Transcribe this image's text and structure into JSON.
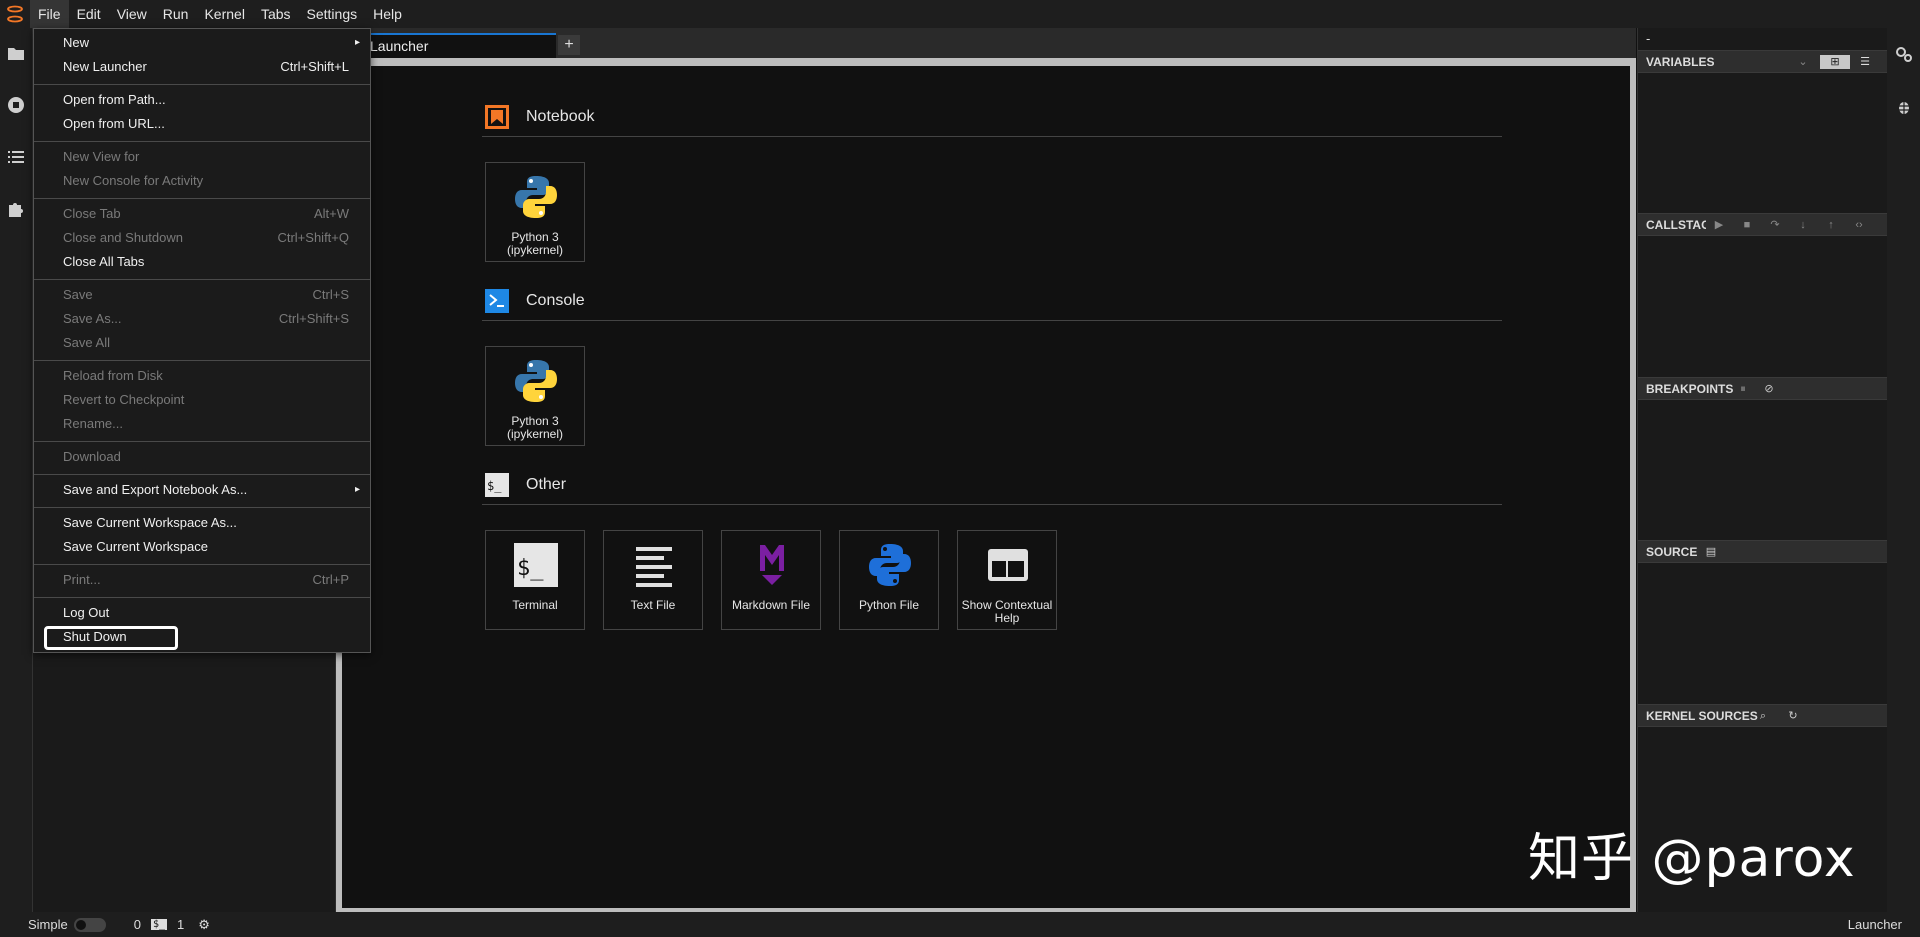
{
  "menubar": {
    "items": [
      "File",
      "Edit",
      "View",
      "Run",
      "Kernel",
      "Tabs",
      "Settings",
      "Help"
    ]
  },
  "tabs": [
    {
      "label": "Launcher"
    }
  ],
  "tab_add": "+",
  "launcher": {
    "sections": [
      {
        "title": "Notebook",
        "cards": [
          {
            "label": "Python 3 (ipykernel)"
          }
        ]
      },
      {
        "title": "Console",
        "cards": [
          {
            "label": "Python 3 (ipykernel)"
          }
        ]
      },
      {
        "title": "Other",
        "cards": [
          {
            "label": "Terminal"
          },
          {
            "label": "Text File"
          },
          {
            "label": "Markdown File"
          },
          {
            "label": "Python File"
          },
          {
            "label": "Show Contextual Help"
          }
        ]
      }
    ]
  },
  "file_menu": {
    "items": [
      {
        "label": "New",
        "shortcut": "",
        "submenu": true,
        "enabled": true
      },
      {
        "label": "New Launcher",
        "shortcut": "Ctrl+Shift+L",
        "enabled": true
      },
      {
        "label": "Open from Path...",
        "shortcut": "",
        "enabled": true
      },
      {
        "label": "Open from URL...",
        "shortcut": "",
        "enabled": true
      },
      {
        "label": "New View for",
        "shortcut": "",
        "enabled": false
      },
      {
        "label": "New Console for Activity",
        "shortcut": "",
        "enabled": false
      },
      {
        "label": "Close Tab",
        "shortcut": "Alt+W",
        "enabled": false
      },
      {
        "label": "Close and Shutdown",
        "shortcut": "Ctrl+Shift+Q",
        "enabled": false
      },
      {
        "label": "Close All Tabs",
        "shortcut": "",
        "enabled": true
      },
      {
        "label": "Save",
        "shortcut": "Ctrl+S",
        "enabled": false
      },
      {
        "label": "Save As...",
        "shortcut": "Ctrl+Shift+S",
        "enabled": false
      },
      {
        "label": "Save All",
        "shortcut": "",
        "enabled": false
      },
      {
        "label": "Reload from Disk",
        "shortcut": "",
        "enabled": false
      },
      {
        "label": "Revert to Checkpoint",
        "shortcut": "",
        "enabled": false
      },
      {
        "label": "Rename...",
        "shortcut": "",
        "enabled": false
      },
      {
        "label": "Download",
        "shortcut": "",
        "enabled": false
      },
      {
        "label": "Save and Export Notebook As...",
        "shortcut": "",
        "submenu": true,
        "enabled": true
      },
      {
        "label": "Save Current Workspace As...",
        "shortcut": "",
        "enabled": true
      },
      {
        "label": "Save Current Workspace",
        "shortcut": "",
        "enabled": true
      },
      {
        "label": "Print...",
        "shortcut": "Ctrl+P",
        "enabled": false
      },
      {
        "label": "Log Out",
        "shortcut": "",
        "enabled": true
      },
      {
        "label": "Shut Down",
        "shortcut": "",
        "enabled": true,
        "highlighted": true
      }
    ]
  },
  "debugger": {
    "top_label": "-",
    "variables": "VARIABLES",
    "callstack": "CALLSTACI",
    "breakpoints": "BREAKPOINTS",
    "source": "SOURCE",
    "kernel_sources": "KERNEL SOURCES"
  },
  "statusbar": {
    "mode_label": "Simple",
    "count_a": "0",
    "terminal_glyph": "$_",
    "count_b": "1",
    "right_label": "Launcher"
  },
  "watermark": "知乎 @parox",
  "icons": {
    "app_logo": "jupyter-logo-icon",
    "folder": "folder-icon",
    "running": "stop-circle-icon",
    "toc": "list-icon",
    "extensions": "puzzle-icon",
    "property_inspector": "gears-icon",
    "debugger": "bug-icon"
  },
  "colors": {
    "accent": "#1976d2",
    "notebook_icon": "#f37726",
    "console_icon": "#1e88e5",
    "markdown_icon": "#7b1fa2"
  }
}
